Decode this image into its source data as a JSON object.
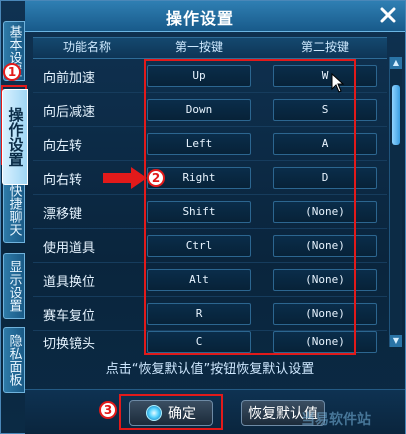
{
  "window": {
    "title": "操作设置"
  },
  "side_tabs": [
    {
      "label": "基本设置",
      "active": false
    },
    {
      "label": "操作设置",
      "active": true
    },
    {
      "label": "快捷聊天",
      "active": false
    },
    {
      "label": "显示设置",
      "active": false
    },
    {
      "label": "隐私面板",
      "active": false
    }
  ],
  "columns": {
    "name": "功能名称",
    "primary": "第一按键",
    "secondary": "第二按键"
  },
  "rows": [
    {
      "label": "向前加速",
      "key1": "Up",
      "key2": "W"
    },
    {
      "label": "向后减速",
      "key1": "Down",
      "key2": "S"
    },
    {
      "label": "向左转",
      "key1": "Left",
      "key2": "A"
    },
    {
      "label": "向右转",
      "key1": "Right",
      "key2": "D"
    },
    {
      "label": "漂移键",
      "key1": "Shift",
      "key2": "(None)"
    },
    {
      "label": "使用道具",
      "key1": "Ctrl",
      "key2": "(None)"
    },
    {
      "label": "道具换位",
      "key1": "Alt",
      "key2": "(None)"
    },
    {
      "label": "赛车复位",
      "key1": "R",
      "key2": "(None)"
    },
    {
      "label": "切换镜头",
      "key1": "C",
      "key2": "(None)"
    }
  ],
  "hint": "点击“恢复默认值”按钮恢复默认设置",
  "buttons": {
    "confirm": "确定",
    "restore": "恢复默认值"
  },
  "annotations": {
    "badge1": "1",
    "badge2": "2",
    "badge3": "3"
  },
  "watermark": "当易软件站",
  "colors": {
    "annotation_red": "#e21a1a",
    "accent_blue": "#2f7fb3"
  }
}
